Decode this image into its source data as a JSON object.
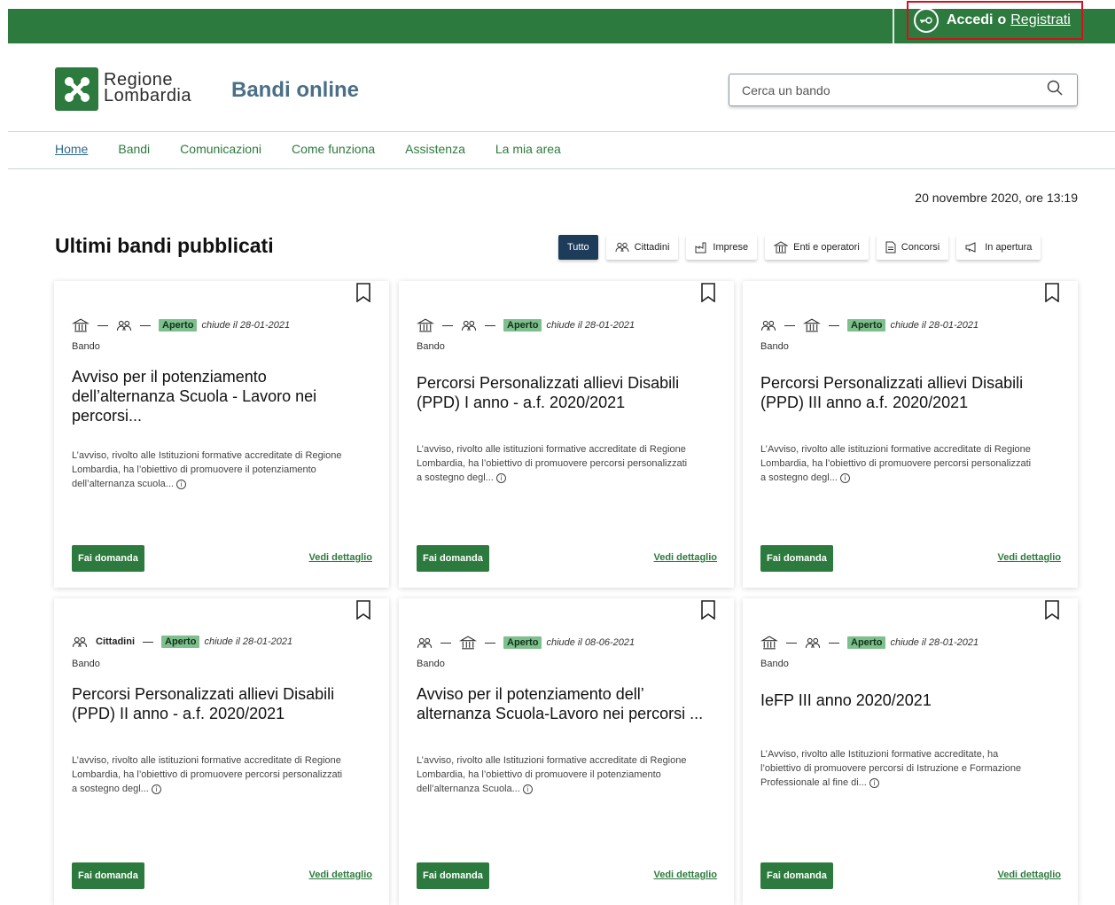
{
  "header": {
    "login_label": "Accedi",
    "or_label": "o",
    "register_label": "Registrati",
    "brand_line1": "Regione",
    "brand_line2": "Lombardia",
    "site_title": "Bandi online",
    "search_placeholder": "Cerca un bando"
  },
  "nav": [
    {
      "label": "Home",
      "active": true
    },
    {
      "label": "Bandi"
    },
    {
      "label": "Comunicazioni"
    },
    {
      "label": "Come funziona"
    },
    {
      "label": "Assistenza"
    },
    {
      "label": "La mia area"
    }
  ],
  "date": "20 novembre 2020, ore 13:19",
  "section_title": "Ultimi bandi pubblicati",
  "filters": [
    {
      "label": "Tutto",
      "icon": "",
      "active": true
    },
    {
      "label": "Cittadini",
      "icon": "people-icon"
    },
    {
      "label": "Imprese",
      "icon": "factory-icon"
    },
    {
      "label": "Enti e operatori",
      "icon": "building-icon"
    },
    {
      "label": "Concorsi",
      "icon": "document-icon"
    },
    {
      "label": "In apertura",
      "icon": "megaphone-icon"
    }
  ],
  "cards": [
    {
      "icons": [
        "building-icon",
        "people-icon"
      ],
      "cat": "",
      "status": "Aperto",
      "closes_prefix": "chiude il",
      "closes_date": "28-01-2021",
      "type": "Bando",
      "title": "Avviso per il potenziamento dell’alternanza Scuola - Lavoro nei percorsi...",
      "desc": "L’avviso, rivolto alle Istituzioni formative accreditate di Regione Lombardia, ha l’obiettivo di promuovere il potenziamento dell’alternanza scuola...",
      "apply": "Fai domanda",
      "detail": "Vedi dettaglio"
    },
    {
      "icons": [
        "building-icon",
        "people-icon"
      ],
      "cat": "",
      "status": "Aperto",
      "closes_prefix": "chiude il",
      "closes_date": "28-01-2021",
      "type": "Bando",
      "title": "Percorsi Personalizzati allievi Disabili (PPD) I anno - a.f. 2020/2021",
      "desc": "L’avviso, rivolto alle istituzioni formative accreditate di Regione Lombardia, ha l’obiettivo di promuovere percorsi personalizzati a sostegno degl...",
      "apply": "Fai domanda",
      "detail": "Vedi dettaglio"
    },
    {
      "icons": [
        "people-icon",
        "building-icon"
      ],
      "cat": "",
      "status": "Aperto",
      "closes_prefix": "chiude il",
      "closes_date": "28-01-2021",
      "type": "Bando",
      "title": "Percorsi Personalizzati allievi Disabili (PPD) III anno a.f. 2020/2021",
      "desc": "L’Avviso, rivolto alle istituzioni formative accreditate di Regione Lombardia, ha l’obiettivo di promuovere percorsi personalizzati a sostegno degl...",
      "apply": "Fai domanda",
      "detail": "Vedi dettaglio"
    },
    {
      "icons": [
        "people-icon"
      ],
      "cat": "Cittadini",
      "status": "Aperto",
      "closes_prefix": "chiude il",
      "closes_date": "28-01-2021",
      "type": "Bando",
      "title": "Percorsi Personalizzati allievi Disabili (PPD) II anno - a.f. 2020/2021",
      "desc": "L’avviso, rivolto alle istituzioni formative accreditate di Regione Lombardia, ha l’obiettivo di promuovere percorsi personalizzati a sostegno degl...",
      "apply": "Fai domanda",
      "detail": "Vedi dettaglio"
    },
    {
      "icons": [
        "people-icon",
        "building-icon"
      ],
      "cat": "",
      "status": "Aperto",
      "closes_prefix": "chiude il",
      "closes_date": "08-06-2021",
      "type": "Bando",
      "title": "Avviso per il potenziamento dell’ alternanza Scuola-Lavoro nei percorsi ...",
      "desc": "L’avviso, rivolto alle Istituzioni formative accreditate di Regione Lombardia, ha l’obiettivo di promuovere il potenziamento dell’alternanza Scuola...",
      "apply": "Fai domanda",
      "detail": "Vedi dettaglio"
    },
    {
      "icons": [
        "building-icon",
        "people-icon"
      ],
      "cat": "",
      "status": "Aperto",
      "closes_prefix": "chiude il",
      "closes_date": "28-01-2021",
      "type": "Bando",
      "title": "IeFP III anno 2020/2021",
      "desc": "L’Avviso, rivolto alle Istituzioni formative accreditate, ha l’obiettivo di promuovere percorsi di Istruzione e Formazione Professionale al fine di...",
      "apply": "Fai domanda",
      "detail": "Vedi dettaglio"
    }
  ]
}
